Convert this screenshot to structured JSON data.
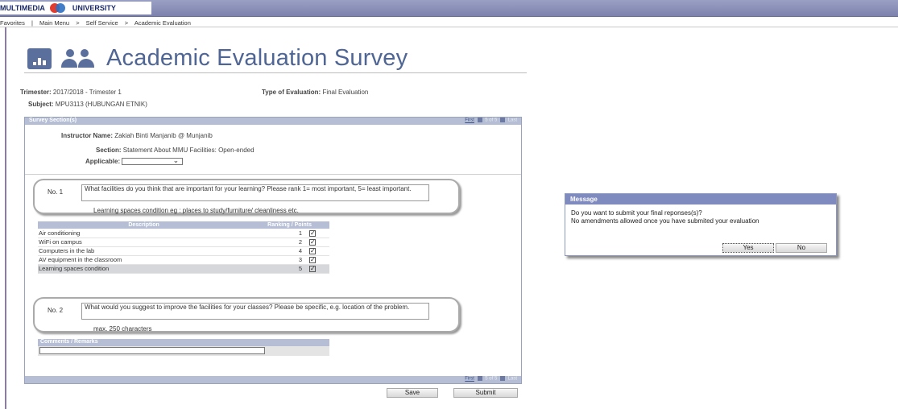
{
  "header": {
    "logo_text_left": "MULTIMEDIA",
    "logo_text_right": "UNIVERSITY"
  },
  "breadcrumb": {
    "items": [
      "Favorites",
      "|",
      "Main Menu",
      ">",
      "Self Service",
      ">",
      "Academic Evaluation"
    ]
  },
  "page": {
    "title": "Academic Evaluation Survey",
    "trimester_label": "Trimester:",
    "trimester_value": "2017/2018 - Trimester 1",
    "type_label": "Type of Evaluation:",
    "type_value": "Final Evaluation",
    "subject_label": "Subject:",
    "subject_value": "MPU3113 (HUBUNGAN ETNIK)"
  },
  "survey": {
    "section_header": "Survey Section(s)",
    "pager": {
      "first": "First",
      "count": "5 of 5",
      "last": "Last"
    },
    "instructor_label": "Instructor Name:",
    "instructor_value": "Zakiah Binti Manjanib @ Munjanib",
    "section_label": "Section:",
    "section_value": "Statement About MMU Facilities: Open-ended",
    "applicable_label": "Applicable:",
    "applicable_value": "",
    "q1": {
      "no": "No. 1",
      "text": "What facilities do you think that are important for your learning? Please rank 1= most important, 5= least important.",
      "hint": "Learning spaces condition eg : places to study/furniture/ cleanliness etc."
    },
    "rank_headers": {
      "desc": "Description",
      "points": "Ranking / Points"
    },
    "rank_rows": [
      {
        "desc": "Air conditioning",
        "points": "1"
      },
      {
        "desc": "WiFi on campus",
        "points": "2"
      },
      {
        "desc": "Computers in the lab",
        "points": "4"
      },
      {
        "desc": "AV equipment in the classroom",
        "points": "3"
      },
      {
        "desc": "Learning spaces condition",
        "points": "5"
      }
    ],
    "q2": {
      "no": "No. 2",
      "text": "What would you suggest to improve the facilities for your classes? Please be specific, e.g. location of the problem.",
      "hint": "max. 250 characters"
    },
    "comments_header": "Comments / Remarks"
  },
  "buttons": {
    "save": "Save",
    "submit": "Submit"
  },
  "dialog": {
    "title": "Message",
    "line1": "Do you want to submit your final reponses(s)?",
    "line2": "No amendments allowed once you have submited your evaluation",
    "yes": "Yes",
    "no": "No"
  },
  "colors": {
    "accent": "#4f6594",
    "panel_header": "#b5bed4",
    "dialog_header": "#7f8abe"
  }
}
